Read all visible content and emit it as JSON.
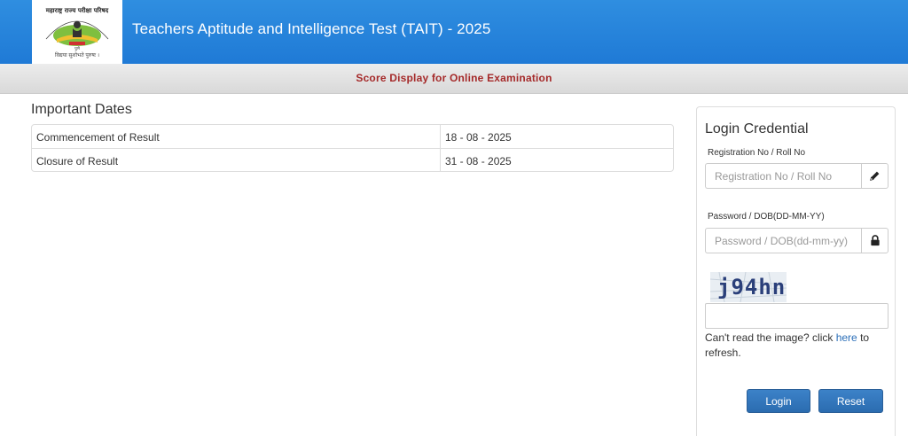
{
  "header": {
    "title": "Teachers Aptitude and Intelligence Test (TAIT) - 2025",
    "logo_top_text": "महाराष्ट्र राज्य परीक्षा परिषद",
    "logo_ribbon_text": "पुणे",
    "logo_tagline": "विद्यया सुशोभते पुरुषः ।"
  },
  "subbar": {
    "title": "Score Display for Online Examination"
  },
  "important_dates": {
    "heading": "Important Dates",
    "rows": [
      {
        "label": "Commencement of Result",
        "value": "18 - 08 - 2025"
      },
      {
        "label": "Closure of Result",
        "value": "31 - 08 - 2025"
      }
    ]
  },
  "login": {
    "title": "Login Credential",
    "registration_label": "Registration No / Roll No",
    "registration_placeholder": "Registration No / Roll No",
    "password_label": "Password / DOB(DD-MM-YY)",
    "password_placeholder": "Password / DOB(dd-mm-yy)",
    "captcha_text": "j94hn",
    "refresh_prefix": "Can't read the image? click ",
    "refresh_link": "here",
    "refresh_suffix": " to refresh.",
    "login_button": "Login",
    "reset_button": "Reset"
  },
  "colors": {
    "header_blue": "#2a86dd",
    "subbar_title": "#a52a2a",
    "button_blue": "#3273b8",
    "link_blue": "#2a6eb8"
  }
}
